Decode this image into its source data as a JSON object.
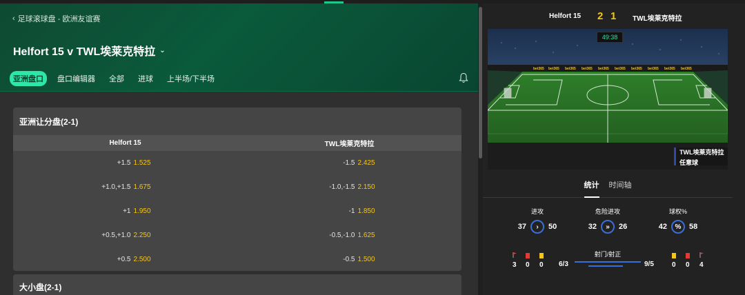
{
  "breadcrumb": "足球滚球盘 - 欧洲友谊赛",
  "match_title": "Helfort 15 v TWL埃莱克特拉",
  "tabs": [
    "亚洲盘口",
    "盘口编辑器",
    "全部",
    "进球",
    "上半场/下半场"
  ],
  "markets": [
    {
      "title": "亚洲让分盘(2-1)",
      "home": "Helfort 15",
      "away": "TWL埃莱克特拉",
      "rows": [
        {
          "h_line": "+1.5",
          "h_odd": "1.525",
          "a_line": "-1.5",
          "a_odd": "2.425"
        },
        {
          "h_line": "+1.0,+1.5",
          "h_odd": "1.675",
          "a_line": "-1.0,-1.5",
          "a_odd": "2.150"
        },
        {
          "h_line": "+1",
          "h_odd": "1.950",
          "a_line": "-1",
          "a_odd": "1.850"
        },
        {
          "h_line": "+0.5,+1.0",
          "h_odd": "2.250",
          "a_line": "-0.5,-1.0",
          "a_odd": "1.625"
        },
        {
          "h_line": "+0.5",
          "h_odd": "2.500",
          "a_line": "-0.5",
          "a_odd": "1.500"
        }
      ]
    },
    {
      "title": "大小盘(2-1)"
    }
  ],
  "scoreboard": {
    "home": "Helfort 15",
    "home_score": "2",
    "away_score": "1",
    "away": "TWL埃莱克特拉",
    "clock": "49:38"
  },
  "event_overlay": {
    "team": "TWL埃莱克特拉",
    "event": "任意球"
  },
  "panel_tabs": [
    "统计",
    "时间轴"
  ],
  "stats": [
    {
      "label": "进攻",
      "home": "37",
      "away": "50",
      "icon": "chevron-right-icon",
      "glyph": "›"
    },
    {
      "label": "危险进攻",
      "home": "32",
      "away": "26",
      "icon": "double-chevron-icon",
      "glyph": "»"
    },
    {
      "label": "球权%",
      "home": "42",
      "away": "58",
      "icon": "percent-icon",
      "glyph": "%"
    }
  ],
  "bottom_stats": {
    "home_corners": "3",
    "home_red": "0",
    "home_yellow": "0",
    "shots_label": "射门/射正",
    "home_shots": "6/3",
    "away_shots": "9/5",
    "away_yellow": "0",
    "away_red": "0",
    "away_corners": "4"
  },
  "colors": {
    "accent": "#2ee6a8",
    "odds": "#f5c518",
    "ring": "#3a6ed8",
    "red": "#e53935",
    "yellow": "#f5c518"
  }
}
